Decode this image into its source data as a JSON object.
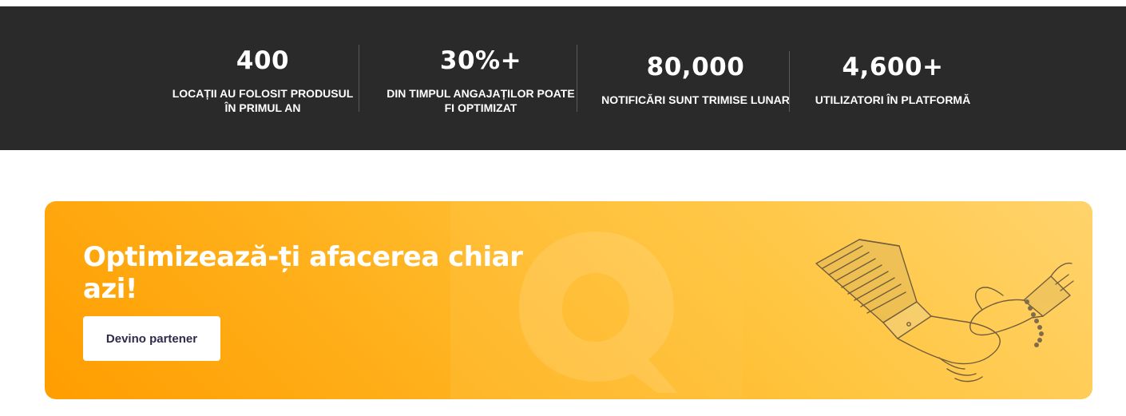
{
  "stats": [
    {
      "value": "400",
      "label_line1": "LOCAȚII AU FOLOSIT PRODUSUL",
      "label_line2": "ÎN PRIMUL AN"
    },
    {
      "value": "30%+",
      "label_line1": "DIN TIMPUL ANGAJAȚILOR POATE",
      "label_line2": "FI OPTIMIZAT"
    },
    {
      "value": "80,000",
      "label_line1": "NOTIFICĂRI SUNT TRIMISE LUNAR",
      "label_line2": ""
    },
    {
      "value": "4,600+",
      "label_line1": "UTILIZATORI ÎN PLATFORMĂ",
      "label_line2": ""
    }
  ],
  "cta": {
    "title_line1": "Optimizează-ți afacerea chiar",
    "title_line2": "azi!",
    "button_label": "Devino partener",
    "illustration": "handshake-illustration",
    "logo_mark": "brand-logo-mark"
  },
  "colors": {
    "stats_background": "#2a2a2a",
    "stats_text": "#ffffff",
    "cta_gradient_start": "#ff9d00",
    "cta_gradient_end": "#ffd36c",
    "button_text": "#2e2a4a"
  }
}
